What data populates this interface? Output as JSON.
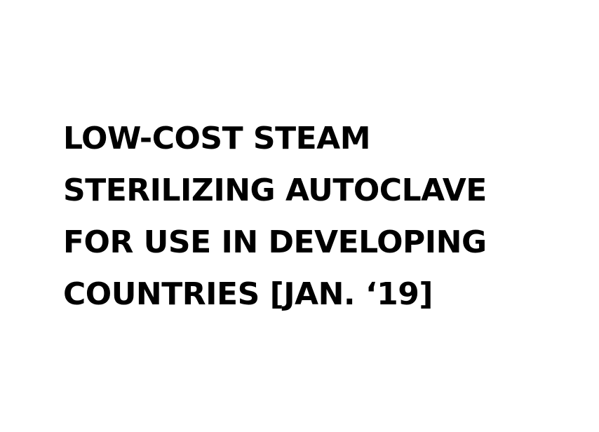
{
  "document": {
    "title_lines": [
      "LOW-COST STEAM",
      "STERILIZING AUTOCLAVE",
      "FOR USE IN DEVELOPING",
      "COUNTRIES [JAN. ‘19]"
    ]
  }
}
